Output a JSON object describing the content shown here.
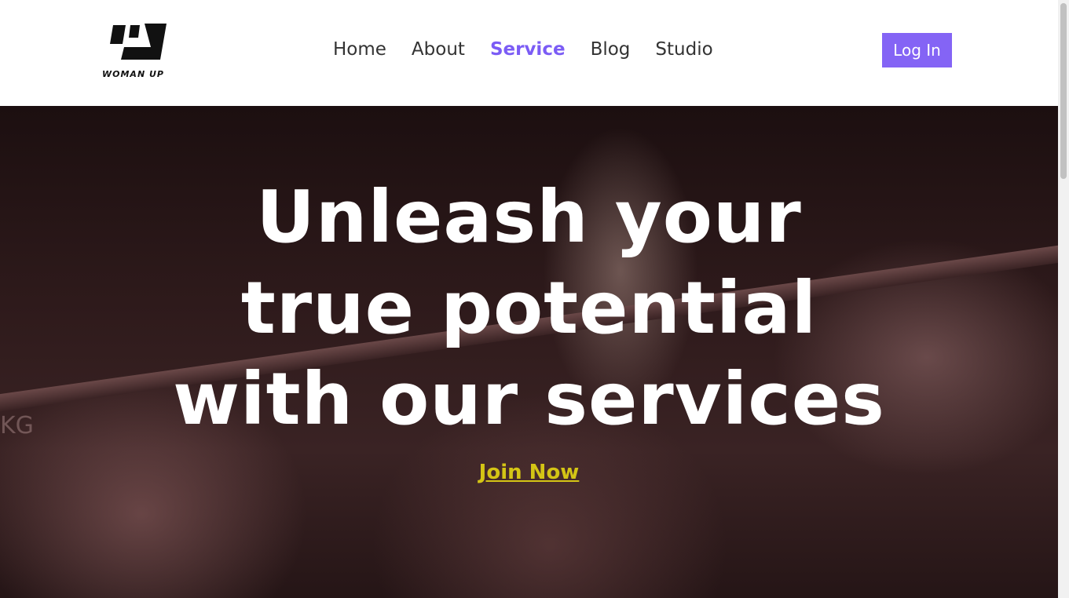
{
  "header": {
    "logo_text": "WOMAN UP",
    "nav": [
      {
        "label": "Home",
        "active": false
      },
      {
        "label": "About",
        "active": false
      },
      {
        "label": "Service",
        "active": true
      },
      {
        "label": "Blog",
        "active": false
      },
      {
        "label": "Studio",
        "active": false
      }
    ],
    "login_label": "Log In"
  },
  "hero": {
    "title_lines": [
      "Unleash your",
      "true potential",
      "with our services"
    ],
    "background_text": "KG",
    "cta_label": "Join Now"
  },
  "colors": {
    "accent": "#7b5cf5",
    "button": "#8464f5",
    "cta": "#d4c515"
  }
}
